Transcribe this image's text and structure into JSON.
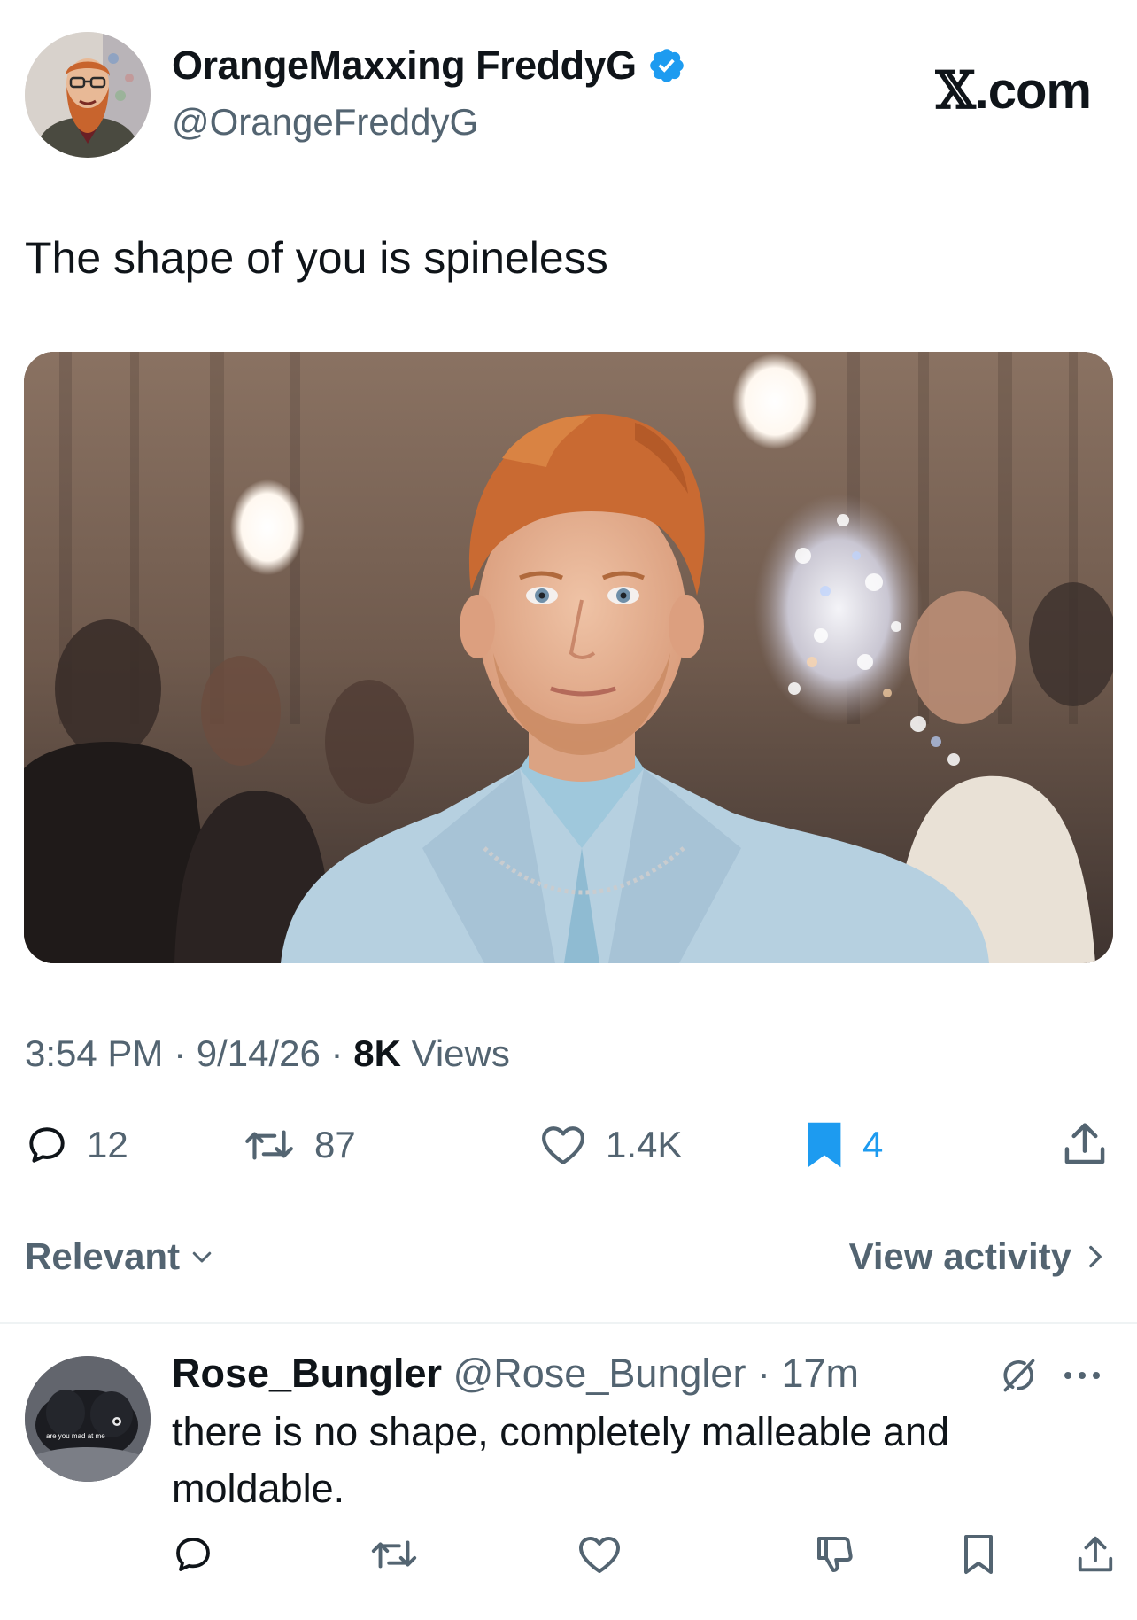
{
  "header": {
    "display_name": "OrangeMaxxing FreddyG",
    "handle": "@OrangeFreddyG",
    "brand_x": "𝕏",
    "brand_suffix": ".com",
    "verified_color": "#1d9bf0"
  },
  "tweet": {
    "text": "The shape of you is spineless",
    "time": "3:54 PM",
    "sep1": " · ",
    "date": "9/14/26",
    "sep2": " · ",
    "views_count": "8K",
    "views_label": " Views"
  },
  "actions": {
    "replies": "12",
    "reposts": "87",
    "likes": "1.4K",
    "bookmarks": "4"
  },
  "sort": {
    "label": "Relevant",
    "view_activity": "View activity"
  },
  "reply": {
    "name": "Rose_Bungler",
    "handle": " @Rose_Bungler",
    "sep": " · ",
    "age": "17m",
    "text": "there is no shape, completely malleable and moldable.",
    "avatar_caption": "are you mad at me"
  },
  "icons": {
    "reply": "reply-icon",
    "repost": "repost-icon",
    "like": "heart-icon",
    "bookmark": "bookmark-icon",
    "share": "share-icon",
    "grok": "grok-icon",
    "more": "more-icon",
    "dislike": "dislike-icon"
  },
  "colors": {
    "accent": "#1d9bf0",
    "secondary_text": "#536471",
    "primary_text": "#0f1419"
  }
}
